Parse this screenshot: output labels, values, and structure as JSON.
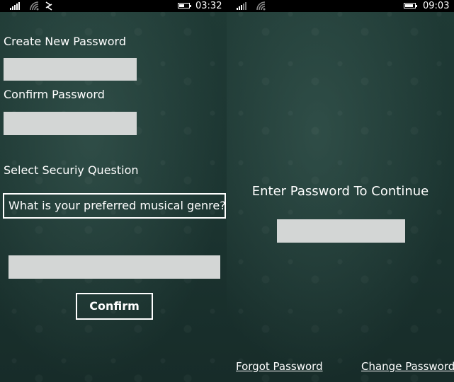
{
  "left_screen": {
    "status_bar": {
      "time": "03:32"
    },
    "create_password_label": "Create New Password",
    "confirm_password_label": "Confirm Password",
    "security_question_label": "Select Securiy Question",
    "security_question_selected": "What is your preferred musical genre?",
    "confirm_button": "Confirm"
  },
  "right_screen": {
    "status_bar": {
      "time": "09:03"
    },
    "prompt": "Enter Password To Continue",
    "forgot_password_link": "Forgot Password",
    "change_password_link": "Change Password"
  },
  "colors": {
    "background": "#1c3531",
    "input_fill": "#d3d6d5",
    "text": "#ffffff",
    "status_bar": "#000000"
  },
  "status": {
    "left_battery_level": 0.5,
    "right_battery_level": 0.85
  }
}
